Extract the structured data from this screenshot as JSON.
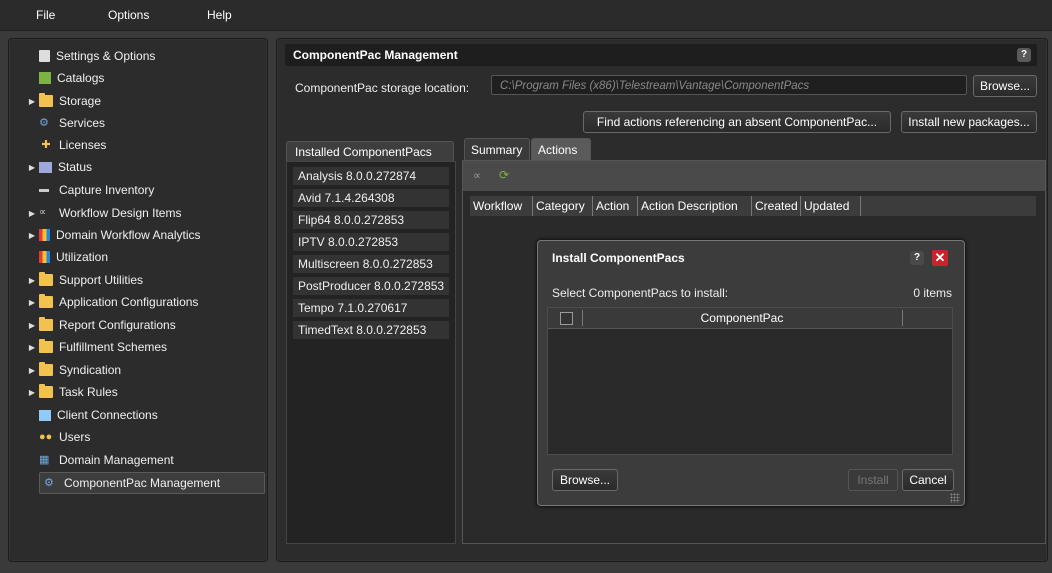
{
  "menu": {
    "file": "File",
    "options": "Options",
    "help": "Help"
  },
  "sidebar": {
    "items": [
      {
        "label": "Settings & Options",
        "icon": "settings-icon"
      },
      {
        "label": "Catalogs",
        "icon": "catalog-icon"
      },
      {
        "label": "Storage",
        "icon": "folder-icon"
      },
      {
        "label": "Services",
        "icon": "services-icon"
      },
      {
        "label": "Licenses",
        "icon": "key-icon"
      },
      {
        "label": "Status",
        "icon": "status-icon"
      },
      {
        "label": "Capture Inventory",
        "icon": "capture-icon"
      },
      {
        "label": "Workflow Design Items",
        "icon": "workflow-icon"
      },
      {
        "label": "Domain Workflow Analytics",
        "icon": "analytics-icon"
      },
      {
        "label": "Utilization",
        "icon": "utilization-icon"
      },
      {
        "label": "Support Utilities",
        "icon": "folder-icon"
      },
      {
        "label": "Application Configurations",
        "icon": "folder-icon"
      },
      {
        "label": "Report Configurations",
        "icon": "folder-icon"
      },
      {
        "label": "Fulfillment Schemes",
        "icon": "folder-icon"
      },
      {
        "label": "Syndication",
        "icon": "folder-icon"
      },
      {
        "label": "Task Rules",
        "icon": "folder-icon"
      },
      {
        "label": "Client Connections",
        "icon": "client-icon"
      },
      {
        "label": "Users",
        "icon": "users-icon"
      },
      {
        "label": "Domain Management",
        "icon": "domain-icon"
      },
      {
        "label": "ComponentPac Management",
        "icon": "componentpac-icon"
      }
    ]
  },
  "main": {
    "title": "ComponentPac Management",
    "help": "?",
    "storage_label": "ComponentPac storage location:",
    "storage_path": "C:\\Program Files (x86)\\Telestream\\Vantage\\ComponentPacs",
    "browse": "Browse...",
    "find_actions": "Find actions referencing an absent ComponentPac...",
    "install_new": "Install new packages..."
  },
  "installed": {
    "header": "Installed ComponentPacs",
    "items": [
      "Analysis 8.0.0.272874",
      "Avid 7.1.4.264308",
      "Flip64 8.0.0.272853",
      "IPTV 8.0.0.272853",
      "Multiscreen 8.0.0.272853",
      "PostProducer 8.0.0.272853",
      "Tempo 7.1.0.270617",
      "TimedText 8.0.0.272853"
    ]
  },
  "tabs": {
    "summary": "Summary",
    "actions": "Actions"
  },
  "actions_table": {
    "columns": [
      "Workflow",
      "Category",
      "Action",
      "Action Description",
      "Created",
      "Updated"
    ]
  },
  "dialog": {
    "title": "Install ComponentPacs",
    "help": "?",
    "close": "✕",
    "prompt": "Select ComponentPacs to install:",
    "count": "0 items",
    "column": "ComponentPac",
    "browse": "Browse...",
    "install": "Install",
    "cancel": "Cancel"
  }
}
